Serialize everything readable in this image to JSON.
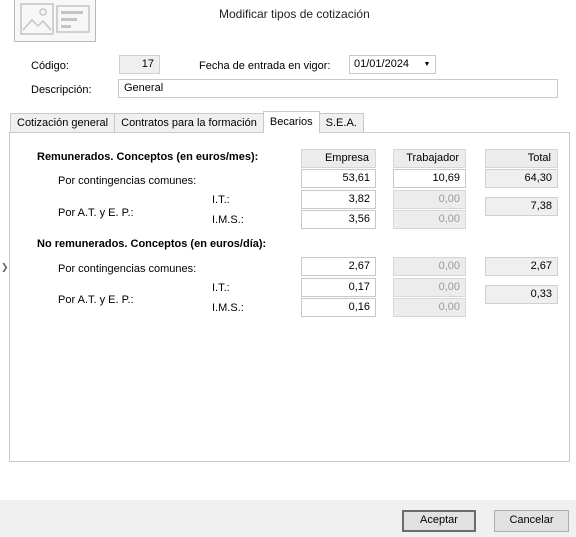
{
  "window": {
    "title": "Modificar tipos de cotización"
  },
  "fields": {
    "codigo_label": "Código:",
    "codigo_value": "17",
    "fecha_label": "Fecha de entrada en vigor:",
    "fecha_value": "01/01/2024",
    "descripcion_label": "Descripción:",
    "descripcion_value": "General"
  },
  "tabs": [
    {
      "label": "Cotización general",
      "active": false
    },
    {
      "label": "Contratos para la formación",
      "active": false
    },
    {
      "label": "Becarios",
      "active": true
    },
    {
      "label": "S.E.A.",
      "active": false
    }
  ],
  "columns": {
    "empresa": "Empresa",
    "trabajador": "Trabajador",
    "total": "Total"
  },
  "remunerados": {
    "title": "Remunerados. Conceptos (en euros/mes):",
    "contingencias_label": "Por contingencias comunes:",
    "atep_label": "Por A.T. y E. P.:",
    "it_label": "I.T.:",
    "ims_label": "I.M.S.:",
    "contingencias": {
      "empresa": "53,61",
      "trabajador": "10,69",
      "total": "64,30"
    },
    "it": {
      "empresa": "3,82",
      "trabajador": "0,00"
    },
    "ims": {
      "empresa": "3,56",
      "trabajador": "0,00"
    },
    "atep_total": "7,38"
  },
  "no_remunerados": {
    "title": "No remunerados. Conceptos (en euros/día):",
    "contingencias_label": "Por contingencias comunes:",
    "atep_label": "Por A.T. y E. P.:",
    "it_label": "I.T.:",
    "ims_label": "I.M.S.:",
    "contingencias": {
      "empresa": "2,67",
      "trabajador": "0,00",
      "total": "2,67"
    },
    "it": {
      "empresa": "0,17",
      "trabajador": "0,00"
    },
    "ims": {
      "empresa": "0,16",
      "trabajador": "0,00"
    },
    "atep_total": "0,33"
  },
  "buttons": {
    "accept": "Aceptar",
    "cancel": "Cancelar"
  },
  "icons": {
    "header": "image-placeholder-icon",
    "dropdown": "chevron-down-icon",
    "side": "chevron-right-icon"
  }
}
